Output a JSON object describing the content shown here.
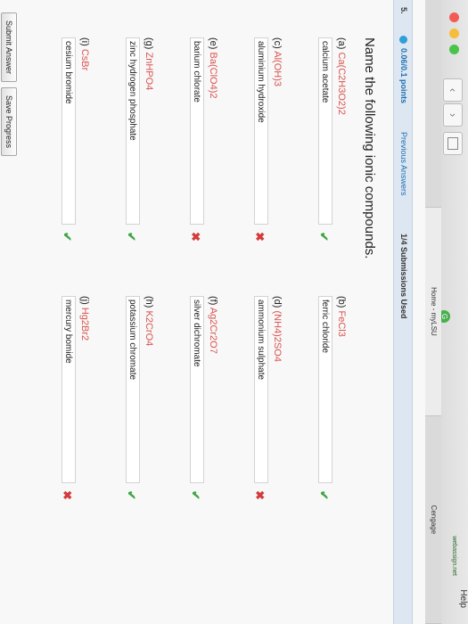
{
  "browser": {
    "menu_help": "Help",
    "tabs": [
      "",
      "Home - myLSU",
      "webassign.net"
    ],
    "cengage": "Cengage"
  },
  "question": {
    "number": "5.",
    "points": "0.06/0.1 points",
    "previous_answers": "Previous Answers",
    "submissions": "1/4 Submissions Used",
    "prompt": "Name the following ionic compounds."
  },
  "items": [
    {
      "label": "(a)",
      "formula": "Ca(C2H3O2)2",
      "answer": "calcium acetate",
      "status": "correct"
    },
    {
      "label": "(b)",
      "formula": "FeCl3",
      "answer": "ferric chloride",
      "status": "correct"
    },
    {
      "label": "(c)",
      "formula": "Al(OH)3",
      "answer": "aluminium hydroxide",
      "status": "incorrect"
    },
    {
      "label": "(d)",
      "formula": "(NH4)2SO4",
      "answer": "ammonium sulphate",
      "status": "incorrect"
    },
    {
      "label": "(e)",
      "formula": "Ba(ClO4)2",
      "answer": "barium chlorate",
      "status": "incorrect"
    },
    {
      "label": "(f)",
      "formula": "Ag2Cr2O7",
      "answer": "silver dichromate",
      "status": "correct"
    },
    {
      "label": "(g)",
      "formula": "ZnHPO4",
      "answer": "zinc hydrogen phosphate",
      "status": "correct"
    },
    {
      "label": "(h)",
      "formula": "K2CrO4",
      "answer": "potassium chromate",
      "status": "correct"
    },
    {
      "label": "(i)",
      "formula": "CsBr",
      "answer": "cesium bromide",
      "status": "correct"
    },
    {
      "label": "(j)",
      "formula": "Hg2Br2",
      "answer": "mercury bomide",
      "status": "incorrect"
    }
  ],
  "buttons": {
    "submit": "Submit Answer",
    "save": "Save Progress"
  },
  "colors": {
    "formula": "#d9534f",
    "correct": "#3ea544",
    "incorrect": "#d23c3c",
    "link": "#1f6fb2"
  }
}
